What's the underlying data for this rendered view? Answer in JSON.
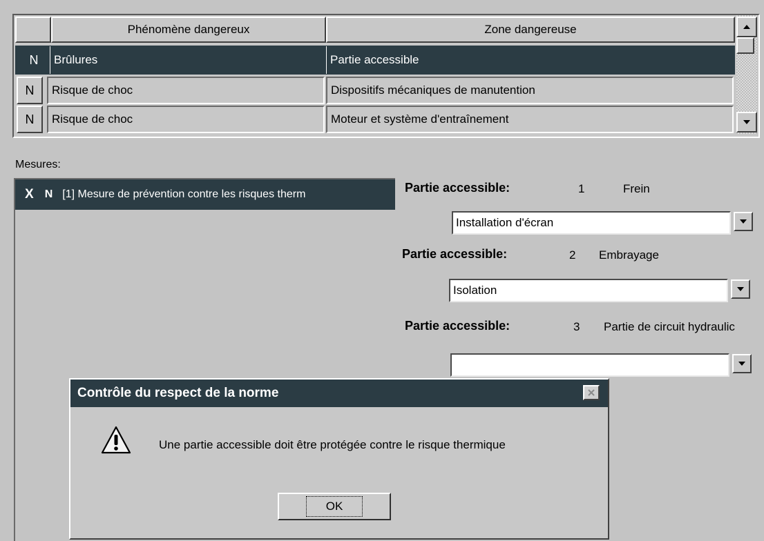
{
  "grid": {
    "headers": {
      "phenomene": "Phénomène dangereux",
      "zone": "Zone dangereuse"
    },
    "rows": [
      {
        "flag": "N",
        "phenomene": "Brûlures",
        "zone": "Partie accessible",
        "selected": true
      },
      {
        "flag": "N",
        "phenomene": "Risque de choc",
        "zone": "Dispositifs mécaniques de manutention",
        "selected": false
      },
      {
        "flag": "N",
        "phenomene": "Risque de choc",
        "zone": "Moteur et système d'entraînement",
        "selected": false
      }
    ],
    "scroll_up_icon": "triangle-up",
    "scroll_down_icon": "triangle-down"
  },
  "mesures": {
    "label": "Mesures:",
    "items": [
      {
        "close": "X",
        "flag": "N",
        "text": "[1] Mesure de prévention contre les risques therm"
      }
    ]
  },
  "parts": [
    {
      "label": "Partie accessible:",
      "num": "1",
      "name": "Frein",
      "value": "Installation d'écran"
    },
    {
      "label": "Partie accessible:",
      "num": "2",
      "name": "Embrayage",
      "value": "Isolation"
    },
    {
      "label": "Partie accessible:",
      "num": "3",
      "name": "Partie de circuit hydraulic",
      "value": ""
    }
  ],
  "dialog": {
    "title": "Contrôle du respect de la norme",
    "message": "Une partie accessible doit être protégée contre le risque thermique",
    "ok_label": "OK",
    "icon": "warning-icon"
  },
  "colors": {
    "background": "#c4c4c4",
    "selection": "#2b3c44",
    "title_bar": "#2b3c44"
  }
}
